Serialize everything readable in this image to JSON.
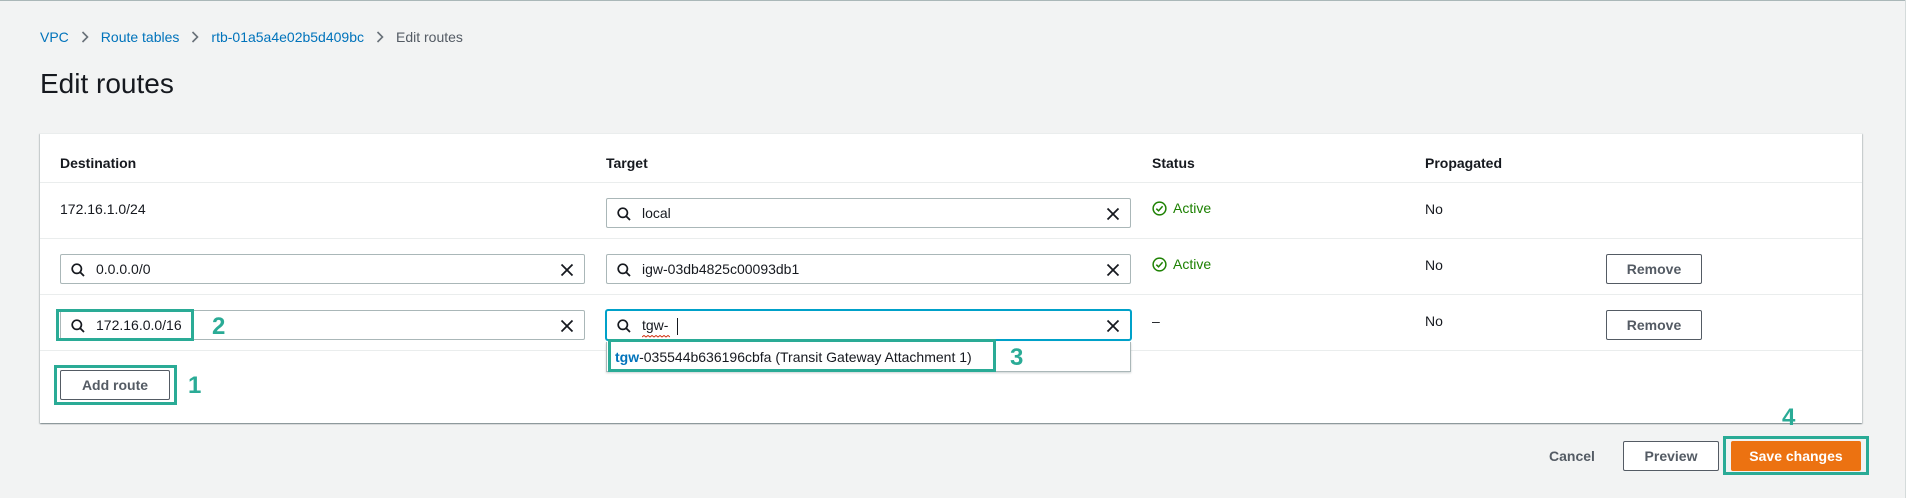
{
  "breadcrumb": {
    "items": [
      "VPC",
      "Route tables",
      "rtb-01a5a4e02b5d409bc"
    ],
    "current": "Edit routes"
  },
  "page": {
    "title": "Edit routes"
  },
  "table": {
    "headers": [
      "Destination",
      "Target",
      "Status",
      "Propagated"
    ],
    "rows": [
      {
        "destination": "172.16.1.0/24",
        "target": "local",
        "status": "Active",
        "propagated": "No"
      },
      {
        "destination": "0.0.0.0/0",
        "target": "igw-03db4825c00093db1",
        "status": "Active",
        "propagated": "No",
        "remove_label": "Remove"
      },
      {
        "destination": "172.16.0.0/16",
        "target": "tgw-",
        "status": "–",
        "propagated": "No",
        "remove_label": "Remove"
      }
    ],
    "autocomplete": {
      "match": "tgw",
      "rest": "-035544b636196cbfa (Transit Gateway Attachment 1)"
    },
    "add_route_label": "Add route"
  },
  "footer": {
    "cancel_label": "Cancel",
    "preview_label": "Preview",
    "save_label": "Save changes"
  },
  "callouts": [
    "1",
    "2",
    "3",
    "4"
  ],
  "colors": {
    "link": "#0073bb",
    "primary": "#ec7211",
    "success": "#1d8102",
    "focus": "#00a1c9",
    "callout": "#2aab96"
  },
  "icons": {
    "chevron": "chevron-right-icon",
    "search": "search-icon",
    "clear": "close-icon",
    "status": "check-circle-icon"
  }
}
